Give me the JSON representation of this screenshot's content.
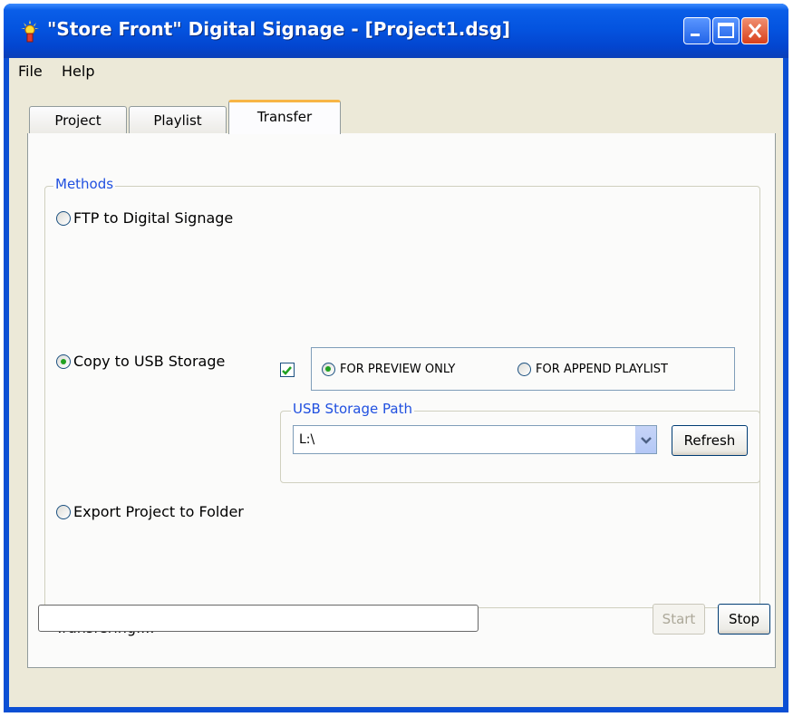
{
  "window": {
    "title": "\"Store Front\" Digital Signage - [Project1.dsg]"
  },
  "menu": {
    "items": [
      "File",
      "Help"
    ]
  },
  "tabs": [
    {
      "label": "Project",
      "active": false
    },
    {
      "label": "Playlist",
      "active": false
    },
    {
      "label": "Transfer",
      "active": true
    }
  ],
  "methods": {
    "group_label": "Methods",
    "ftp_label": "FTP to Digital Signage",
    "ftp_selected": false,
    "usb_label": "Copy to USB Storage",
    "usb_selected": true,
    "export_label": "Export Project to Folder",
    "export_selected": false
  },
  "usb_options": {
    "checkbox_checked": true,
    "preview_label": "FOR PREVIEW ONLY",
    "preview_selected": true,
    "append_label": "FOR APPEND PLAYLIST",
    "append_selected": false
  },
  "usb_path": {
    "group_label": "USB Storage Path",
    "value": "L:\\",
    "refresh_label": "Refresh"
  },
  "status_text": "Transfering....",
  "progress": 0,
  "buttons": {
    "start_label": "Start",
    "start_enabled": false,
    "stop_label": "Stop"
  },
  "colors": {
    "titlebar": "#0454e0",
    "face": "#ece9d8",
    "group_label": "#2050e0",
    "radio_dot": "#21a121",
    "active_tab_accent": "#f7b545"
  }
}
